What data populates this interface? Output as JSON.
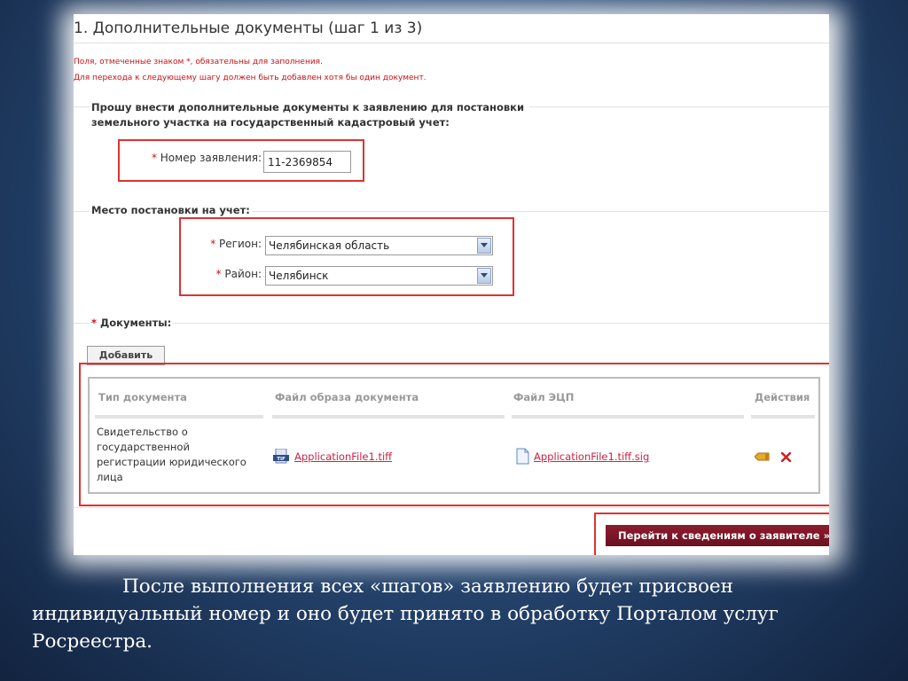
{
  "form": {
    "title": "1. Дополнительные документы (шаг 1 из 3)",
    "note1": "Поля, отмеченные знаком *, обязательны для заполнения.",
    "note2": "Для перехода к следующему шагу должен быть добавлен хотя бы один документ.",
    "section1": {
      "label_line1": "Прошу внести дополнительные документы к заявлению для постановки",
      "label_line2": "земельного участка на государственный кадастровый учет:",
      "application_number_label": "Номер заявления:",
      "application_number_value": "11-2369854"
    },
    "section2": {
      "label": "Место постановки на учет:",
      "region_label": "Регион:",
      "region_value": "Челябинская область",
      "district_label": "Район:",
      "district_value": "Челябинск"
    },
    "documents": {
      "label": "Документы:",
      "required_mark": "*",
      "add_button": "Добавить",
      "columns": [
        "Тип документа",
        "Файл образа документа",
        "Файл ЭЦП",
        "Действия"
      ],
      "rows": [
        {
          "type_lines": [
            "Свидетельство о",
            "государственной",
            "регистрации юридического",
            "лица"
          ],
          "image_file": "ApplicationFile1.tiff",
          "sig_file": "ApplicationFile1.tiff.sig"
        }
      ]
    },
    "next_button": "Перейти к сведениям о заявителе »"
  },
  "icons": {
    "tiff": "tiff-file-icon",
    "sig": "document-file-icon",
    "edit": "pencil-edit-icon",
    "delete": "delete-x-icon"
  },
  "colors": {
    "accent": "#cc2244",
    "button": "#7a1525",
    "highlight": "#dd3333"
  },
  "caption": {
    "line1": "После выполнения всех «шагов» заявлению будет  присвоен",
    "line2": "индивидуальный номер и оно будет принято в обработку Порталом услуг",
    "line3": "Росреестра."
  }
}
